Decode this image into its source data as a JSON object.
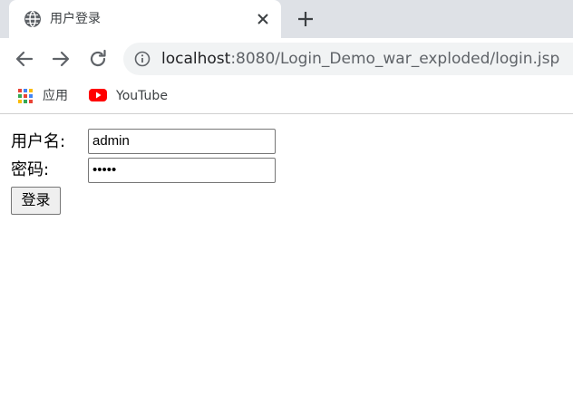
{
  "tab": {
    "title": "用户登录",
    "favicon": "globe-icon",
    "close_icon": "close-icon"
  },
  "new_tab_icon": "plus-icon",
  "toolbar": {
    "back_icon": "arrow-left-icon",
    "forward_icon": "arrow-right-icon",
    "reload_icon": "reload-icon",
    "site_info_icon": "info-icon",
    "url_host": "localhost",
    "url_rest": ":8080/Login_Demo_war_exploded/login.jsp"
  },
  "bookmarks": [
    {
      "label": "应用",
      "icon": "apps-grid-icon"
    },
    {
      "label": "YouTube",
      "icon": "youtube-icon"
    }
  ],
  "form": {
    "username_label": "用户名:",
    "username_value": "admin",
    "password_label": "密码:",
    "password_value": "•••••",
    "submit_label": "登录"
  },
  "colors": {
    "tabstrip": "#dee1e6",
    "omnibox": "#f1f3f4",
    "youtube_red": "#ff0000"
  }
}
